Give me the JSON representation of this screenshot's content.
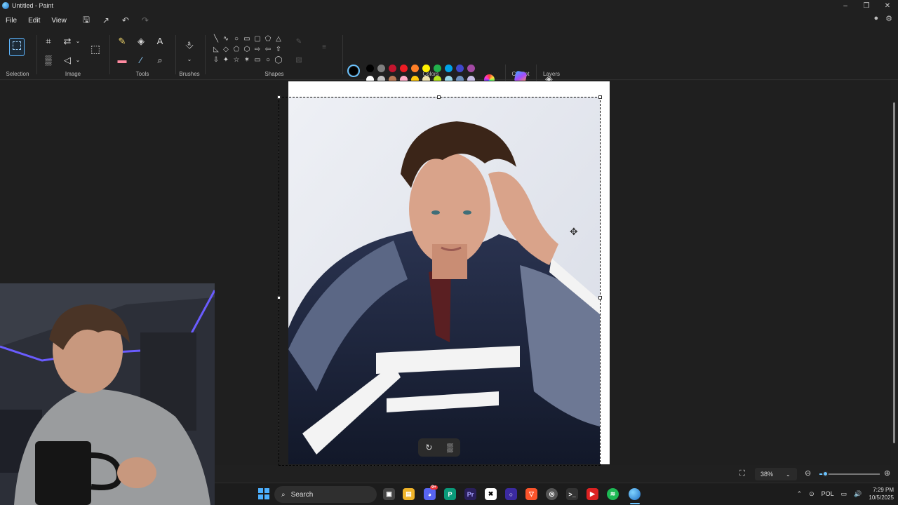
{
  "window": {
    "title": "Untitled - Paint"
  },
  "menu": {
    "file": "File",
    "edit": "Edit",
    "view": "View"
  },
  "ribbon": {
    "selection_label": "Selection",
    "image_label": "Image",
    "tools_label": "Tools",
    "brushes_label": "Brushes",
    "shapes_label": "Shapes",
    "colors_label": "Colors",
    "copilot_label": "Copilot",
    "layers_label": "Layers"
  },
  "colors": {
    "primary": "#000000",
    "secondary": "#ffffff",
    "row1": [
      "#000000",
      "#7f7f7f",
      "#c3152e",
      "#ec1c24",
      "#ff7f27",
      "#fff200",
      "#22b14c",
      "#00a2e8",
      "#3f48cc",
      "#a349a4"
    ],
    "row2": [
      "#ffffff",
      "#c3c3c3",
      "#b97a57",
      "#ffaec9",
      "#ffc90e",
      "#efe4b0",
      "#b5e61d",
      "#99d9ea",
      "#7092be",
      "#c8bfe7"
    ],
    "accent": "#6cc4ff"
  },
  "status": {
    "zoom": "38%"
  },
  "taskbar": {
    "search_placeholder": "Search",
    "language": "POL",
    "time": "7:29 PM",
    "date": "10/5/2025",
    "discord_badge": "9+"
  }
}
